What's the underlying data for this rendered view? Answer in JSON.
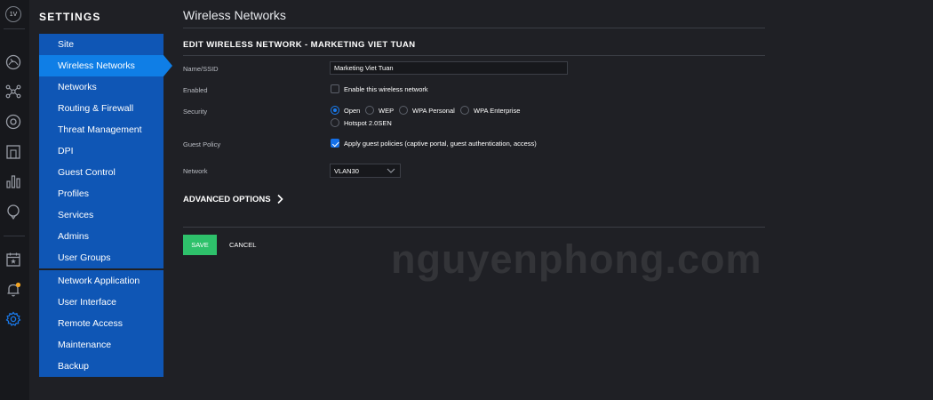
{
  "user": {
    "initials": "1V"
  },
  "rail": {
    "icons": [
      "dashboard-icon",
      "topology-icon",
      "devices-icon",
      "clients-icon",
      "statistics-icon",
      "insights-icon",
      "events-icon",
      "alerts-icon",
      "settings-icon"
    ],
    "accent_color": "#1a7cf0",
    "notification_dot_color": "#f5a623"
  },
  "sidebar": {
    "title": "SETTINGS",
    "group1": [
      {
        "label": "Site"
      },
      {
        "label": "Wireless Networks"
      },
      {
        "label": "Networks"
      },
      {
        "label": "Routing & Firewall"
      },
      {
        "label": "Threat Management"
      },
      {
        "label": "DPI"
      },
      {
        "label": "Guest Control"
      },
      {
        "label": "Profiles"
      },
      {
        "label": "Services"
      },
      {
        "label": "Admins"
      },
      {
        "label": "User Groups"
      }
    ],
    "group2": [
      {
        "label": "Network Application"
      },
      {
        "label": "User Interface"
      },
      {
        "label": "Remote Access"
      },
      {
        "label": "Maintenance"
      },
      {
        "label": "Backup"
      }
    ],
    "active": "Wireless Networks"
  },
  "main": {
    "page_title": "Wireless Networks",
    "section_title": "EDIT WIRELESS NETWORK - MARKETING VIET TUAN",
    "form": {
      "ssid": {
        "label": "Name/SSID",
        "value": "Marketing Viet Tuan"
      },
      "enabled": {
        "label": "Enabled",
        "checkbox_label": "Enable this wireless network",
        "checked": false
      },
      "security": {
        "label": "Security",
        "options": [
          {
            "label": "Open",
            "checked": true
          },
          {
            "label": "WEP",
            "checked": false
          },
          {
            "label": "WPA Personal",
            "checked": false
          },
          {
            "label": "WPA Enterprise",
            "checked": false
          },
          {
            "label": "Hotspot 2.0SEN",
            "checked": false
          }
        ]
      },
      "guest_policy": {
        "label": "Guest Policy",
        "checkbox_label": "Apply guest policies (captive portal, guest authentication, access)",
        "checked": true
      },
      "network": {
        "label": "Network",
        "value": "VLAN30"
      }
    },
    "advanced_options_label": "ADVANCED OPTIONS",
    "save_label": "SAVE",
    "cancel_label": "CANCEL",
    "save_color": "#2ec16b"
  },
  "watermark": "nguyenphong.com"
}
